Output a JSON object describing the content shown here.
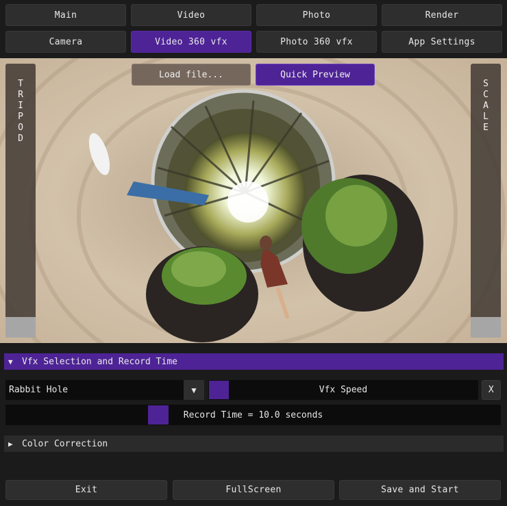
{
  "tabs_row1": [
    "Main",
    "Video",
    "Photo",
    "Render"
  ],
  "tabs_row2": [
    "Camera",
    "Video 360 vfx",
    "Photo 360 vfx",
    "App Settings"
  ],
  "active_tab": "Video 360 vfx",
  "viewport": {
    "load_button": "Load file...",
    "preview_button": "Quick Preview",
    "left_slider_label": "TRIPOD",
    "right_slider_label": "SCALE"
  },
  "vfx_section": {
    "header": "Vfx Selection and Record Time",
    "effect_value": "Rabbit Hole",
    "speed_label": "Vfx Speed",
    "clear_button": "X",
    "record_label": "Record Time = 10.0 seconds",
    "record_fraction": 0.3
  },
  "color_section": {
    "header": "Color Correction"
  },
  "footer": {
    "exit": "Exit",
    "fullscreen": "FullScreen",
    "save_start": "Save and Start"
  },
  "colors": {
    "accent": "#4e2396",
    "panel": "#2e2e2e",
    "background": "#1b1b1b"
  },
  "icons": {
    "expanded": "triangle-down-icon",
    "collapsed": "triangle-right-icon",
    "dropdown": "dropdown-arrow-icon"
  }
}
